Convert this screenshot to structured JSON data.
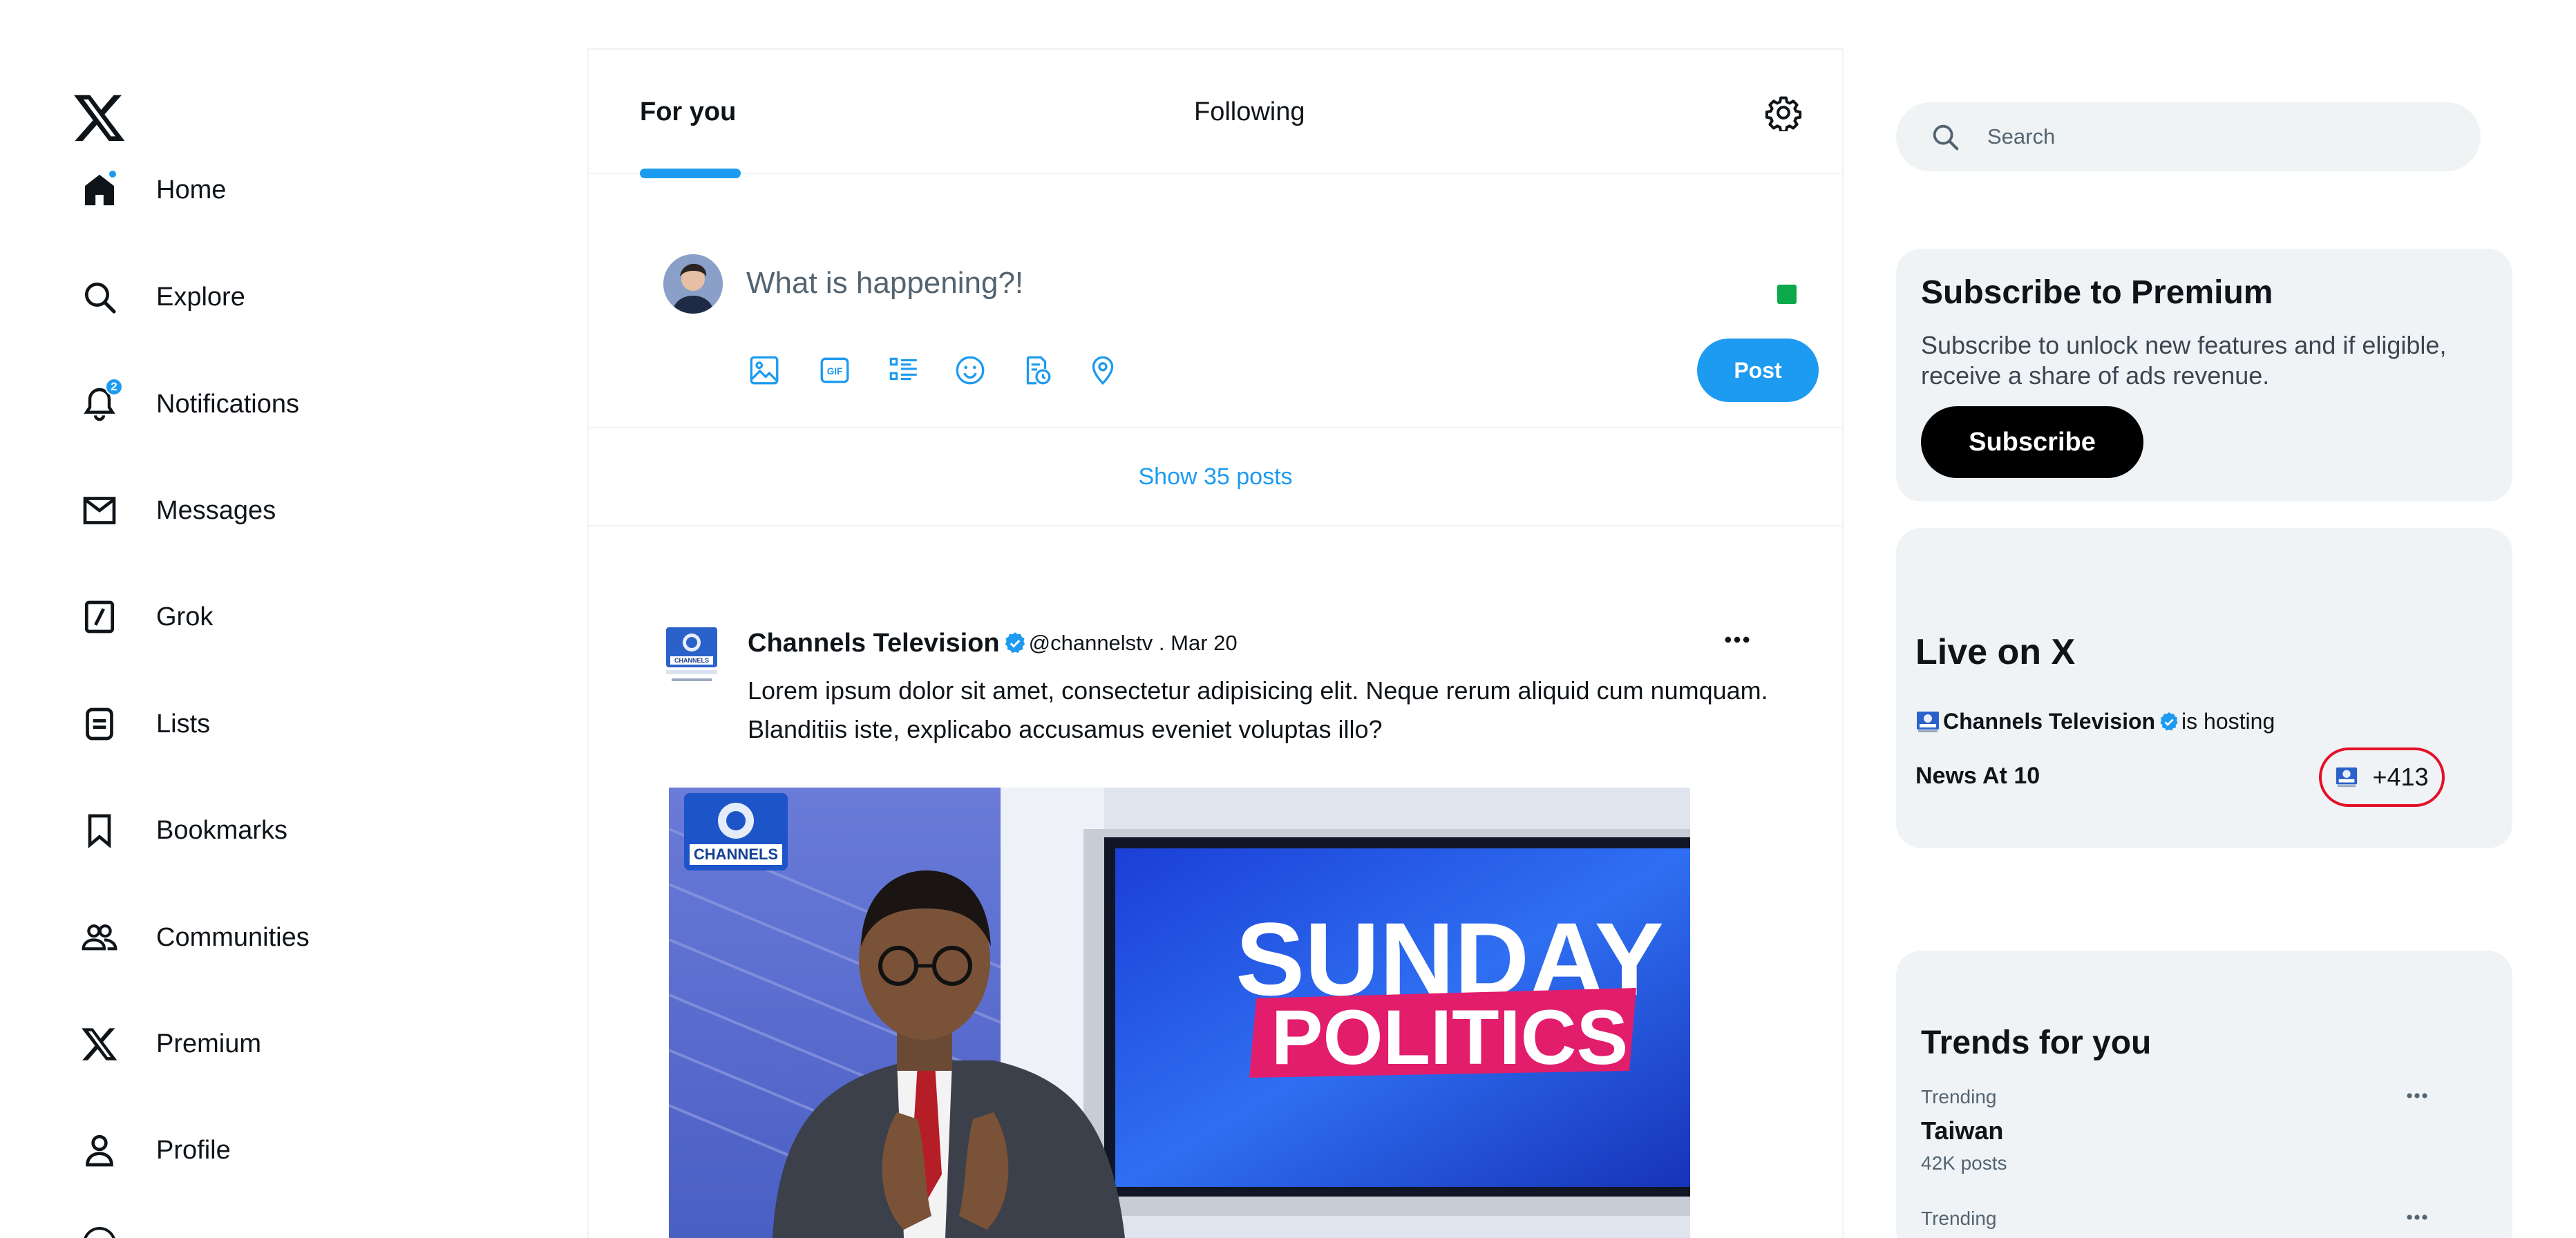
{
  "nav": {
    "logo": "x-logo-icon",
    "items": [
      {
        "label": "Home",
        "icon": "home-icon"
      },
      {
        "label": "Explore",
        "icon": "search-icon"
      },
      {
        "label": "Notifications",
        "icon": "bell-icon",
        "badge": "2"
      },
      {
        "label": "Messages",
        "icon": "envelope-icon"
      },
      {
        "label": "Grok",
        "icon": "grok-icon"
      },
      {
        "label": "Lists",
        "icon": "list-icon"
      },
      {
        "label": "Bookmarks",
        "icon": "bookmark-icon"
      },
      {
        "label": "Communities",
        "icon": "people-icon"
      },
      {
        "label": "Premium",
        "icon": "x-logo-icon"
      },
      {
        "label": "Profile",
        "icon": "person-icon"
      }
    ]
  },
  "tabs": {
    "for_you": "For you",
    "following": "Following"
  },
  "composer": {
    "placeholder": "What is happening?!",
    "post_label": "Post",
    "tools": [
      "image-icon",
      "gif-icon",
      "poll-icon",
      "emoji-icon",
      "schedule-icon",
      "location-icon"
    ]
  },
  "feed": {
    "show_posts": "Show 35 posts"
  },
  "tweet": {
    "author": "Channels Television",
    "handle_date": "@channelstv . Mar 20",
    "text": "Lorem ipsum dolor sit amet, consectetur adipisicing elit. Neque rerum aliquid cum numquam. Blanditiis iste, explicabo accusamus eveniet voluptas illo?",
    "media": {
      "channel_logo": "CHANNELS",
      "screen_line1": "SUNDAY",
      "screen_line2": "POLITICS"
    }
  },
  "search": {
    "placeholder": "Search"
  },
  "premium": {
    "title": "Subscribe to Premium",
    "description": "Subscribe to unlock new features and if eligible, receive a share of ads revenue.",
    "button": "Subscribe"
  },
  "live": {
    "title": "Live on X",
    "host_name": "Channels Television",
    "host_suffix": "is hosting",
    "show": "News At 10",
    "count": "+413"
  },
  "trends": {
    "title": "Trends for you",
    "items": [
      {
        "label": "Trending",
        "name": "Taiwan",
        "count": "42K posts"
      },
      {
        "label": "Trending",
        "name": "",
        "count": ""
      }
    ]
  },
  "colors": {
    "accent": "#1d9bf0",
    "text": "#0f1419",
    "muted": "#536471",
    "card_bg": "#f0f3f5",
    "live_ring": "#e3102a"
  }
}
